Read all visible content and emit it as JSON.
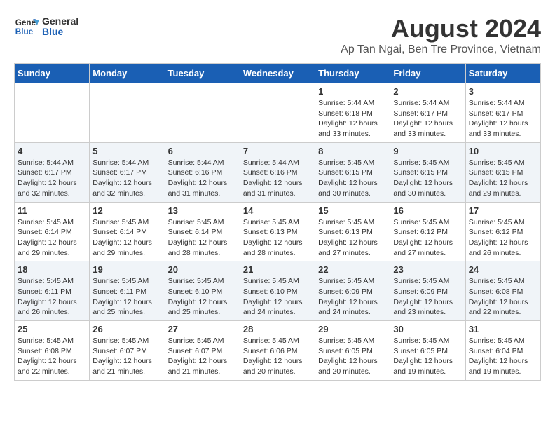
{
  "logo": {
    "line1": "General",
    "line2": "Blue"
  },
  "title": "August 2024",
  "subtitle": "Ap Tan Ngai, Ben Tre Province, Vietnam",
  "weekdays": [
    "Sunday",
    "Monday",
    "Tuesday",
    "Wednesday",
    "Thursday",
    "Friday",
    "Saturday"
  ],
  "weeks": [
    [
      {
        "day": "",
        "info": ""
      },
      {
        "day": "",
        "info": ""
      },
      {
        "day": "",
        "info": ""
      },
      {
        "day": "",
        "info": ""
      },
      {
        "day": "1",
        "info": "Sunrise: 5:44 AM\nSunset: 6:18 PM\nDaylight: 12 hours\nand 33 minutes."
      },
      {
        "day": "2",
        "info": "Sunrise: 5:44 AM\nSunset: 6:17 PM\nDaylight: 12 hours\nand 33 minutes."
      },
      {
        "day": "3",
        "info": "Sunrise: 5:44 AM\nSunset: 6:17 PM\nDaylight: 12 hours\nand 33 minutes."
      }
    ],
    [
      {
        "day": "4",
        "info": "Sunrise: 5:44 AM\nSunset: 6:17 PM\nDaylight: 12 hours\nand 32 minutes."
      },
      {
        "day": "5",
        "info": "Sunrise: 5:44 AM\nSunset: 6:17 PM\nDaylight: 12 hours\nand 32 minutes."
      },
      {
        "day": "6",
        "info": "Sunrise: 5:44 AM\nSunset: 6:16 PM\nDaylight: 12 hours\nand 31 minutes."
      },
      {
        "day": "7",
        "info": "Sunrise: 5:44 AM\nSunset: 6:16 PM\nDaylight: 12 hours\nand 31 minutes."
      },
      {
        "day": "8",
        "info": "Sunrise: 5:45 AM\nSunset: 6:15 PM\nDaylight: 12 hours\nand 30 minutes."
      },
      {
        "day": "9",
        "info": "Sunrise: 5:45 AM\nSunset: 6:15 PM\nDaylight: 12 hours\nand 30 minutes."
      },
      {
        "day": "10",
        "info": "Sunrise: 5:45 AM\nSunset: 6:15 PM\nDaylight: 12 hours\nand 29 minutes."
      }
    ],
    [
      {
        "day": "11",
        "info": "Sunrise: 5:45 AM\nSunset: 6:14 PM\nDaylight: 12 hours\nand 29 minutes."
      },
      {
        "day": "12",
        "info": "Sunrise: 5:45 AM\nSunset: 6:14 PM\nDaylight: 12 hours\nand 29 minutes."
      },
      {
        "day": "13",
        "info": "Sunrise: 5:45 AM\nSunset: 6:14 PM\nDaylight: 12 hours\nand 28 minutes."
      },
      {
        "day": "14",
        "info": "Sunrise: 5:45 AM\nSunset: 6:13 PM\nDaylight: 12 hours\nand 28 minutes."
      },
      {
        "day": "15",
        "info": "Sunrise: 5:45 AM\nSunset: 6:13 PM\nDaylight: 12 hours\nand 27 minutes."
      },
      {
        "day": "16",
        "info": "Sunrise: 5:45 AM\nSunset: 6:12 PM\nDaylight: 12 hours\nand 27 minutes."
      },
      {
        "day": "17",
        "info": "Sunrise: 5:45 AM\nSunset: 6:12 PM\nDaylight: 12 hours\nand 26 minutes."
      }
    ],
    [
      {
        "day": "18",
        "info": "Sunrise: 5:45 AM\nSunset: 6:11 PM\nDaylight: 12 hours\nand 26 minutes."
      },
      {
        "day": "19",
        "info": "Sunrise: 5:45 AM\nSunset: 6:11 PM\nDaylight: 12 hours\nand 25 minutes."
      },
      {
        "day": "20",
        "info": "Sunrise: 5:45 AM\nSunset: 6:10 PM\nDaylight: 12 hours\nand 25 minutes."
      },
      {
        "day": "21",
        "info": "Sunrise: 5:45 AM\nSunset: 6:10 PM\nDaylight: 12 hours\nand 24 minutes."
      },
      {
        "day": "22",
        "info": "Sunrise: 5:45 AM\nSunset: 6:09 PM\nDaylight: 12 hours\nand 24 minutes."
      },
      {
        "day": "23",
        "info": "Sunrise: 5:45 AM\nSunset: 6:09 PM\nDaylight: 12 hours\nand 23 minutes."
      },
      {
        "day": "24",
        "info": "Sunrise: 5:45 AM\nSunset: 6:08 PM\nDaylight: 12 hours\nand 22 minutes."
      }
    ],
    [
      {
        "day": "25",
        "info": "Sunrise: 5:45 AM\nSunset: 6:08 PM\nDaylight: 12 hours\nand 22 minutes."
      },
      {
        "day": "26",
        "info": "Sunrise: 5:45 AM\nSunset: 6:07 PM\nDaylight: 12 hours\nand 21 minutes."
      },
      {
        "day": "27",
        "info": "Sunrise: 5:45 AM\nSunset: 6:07 PM\nDaylight: 12 hours\nand 21 minutes."
      },
      {
        "day": "28",
        "info": "Sunrise: 5:45 AM\nSunset: 6:06 PM\nDaylight: 12 hours\nand 20 minutes."
      },
      {
        "day": "29",
        "info": "Sunrise: 5:45 AM\nSunset: 6:05 PM\nDaylight: 12 hours\nand 20 minutes."
      },
      {
        "day": "30",
        "info": "Sunrise: 5:45 AM\nSunset: 6:05 PM\nDaylight: 12 hours\nand 19 minutes."
      },
      {
        "day": "31",
        "info": "Sunrise: 5:45 AM\nSunset: 6:04 PM\nDaylight: 12 hours\nand 19 minutes."
      }
    ]
  ],
  "colors": {
    "header_bg": "#1a5fb4",
    "header_text": "#ffffff",
    "accent": "#1a5fb4"
  }
}
